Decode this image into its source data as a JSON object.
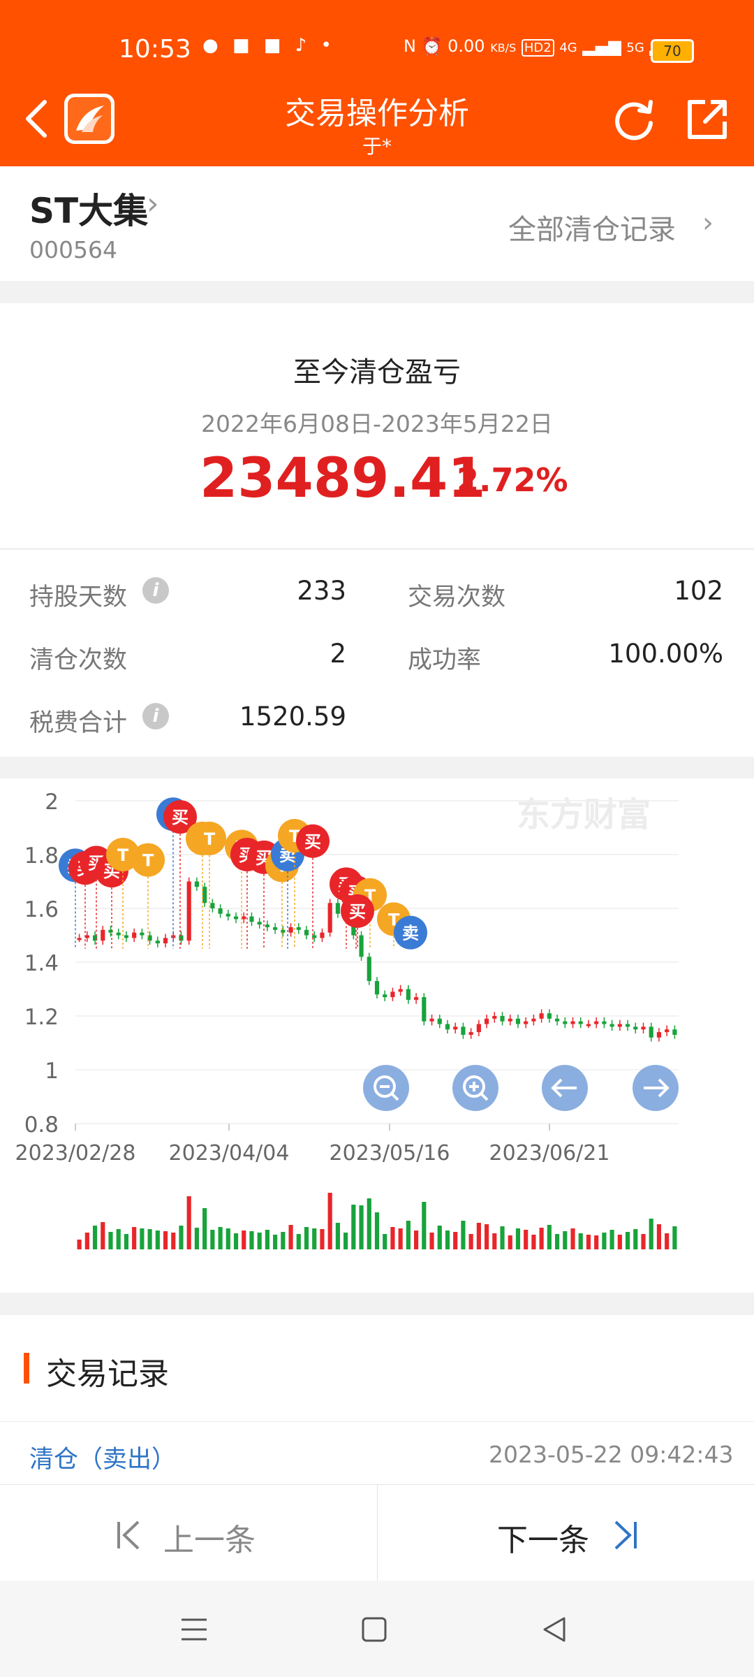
{
  "status_bar": {
    "time": "10:53",
    "net_speed": "0.00",
    "net_unit": "KB/S",
    "signal_4g": "4G",
    "signal_5g": "5G",
    "battery": "70",
    "hd": "HD2"
  },
  "header": {
    "title": "交易操作分析",
    "subtitle": "于*"
  },
  "stock": {
    "name": "ST大集",
    "code": "000564",
    "all_records_label": "全部清仓记录"
  },
  "pnl": {
    "title": "至今清仓盈亏",
    "date_range": "2022年6月08日-2023年5月22日",
    "amount": "23489.41",
    "percent": "2.72%"
  },
  "stats": {
    "holding_days_label": "持股天数",
    "holding_days": "233",
    "trade_count_label": "交易次数",
    "trade_count": "102",
    "clear_count_label": "清仓次数",
    "clear_count": "2",
    "success_rate_label": "成功率",
    "success_rate": "100.00%",
    "fees_label": "税费合计",
    "fees": "1520.59"
  },
  "chart_data": {
    "type": "candlestick",
    "watermark": "东方财富",
    "ylim": [
      0.8,
      2.0
    ],
    "yticks": [
      "2",
      "1.8",
      "1.6",
      "1.4",
      "1.2",
      "1",
      "0.8"
    ],
    "xticks": [
      "2023/02/28",
      "2023/04/04",
      "2023/05/16",
      "2023/06/21"
    ],
    "price_series": [
      1.49,
      1.5,
      1.48,
      1.52,
      1.51,
      1.5,
      1.49,
      1.51,
      1.5,
      1.48,
      1.47,
      1.49,
      1.5,
      1.48,
      1.7,
      1.68,
      1.62,
      1.6,
      1.58,
      1.57,
      1.56,
      1.57,
      1.55,
      1.54,
      1.53,
      1.52,
      1.51,
      1.53,
      1.52,
      1.5,
      1.49,
      1.51,
      1.62,
      1.58,
      1.57,
      1.5,
      1.42,
      1.33,
      1.28,
      1.27,
      1.29,
      1.3,
      1.26,
      1.27,
      1.18,
      1.19,
      1.17,
      1.15,
      1.16,
      1.13,
      1.14,
      1.17,
      1.19,
      1.2,
      1.18,
      1.19,
      1.17,
      1.18,
      1.19,
      1.21,
      1.19,
      1.18,
      1.17,
      1.18,
      1.17,
      1.17,
      1.18,
      1.17,
      1.16,
      1.17,
      1.16,
      1.15,
      1.16,
      1.12,
      1.14,
      1.15,
      1.13
    ],
    "markers": [
      {
        "label": "卖",
        "color": "#3a7bd5",
        "price": 1.76
      },
      {
        "label": "买",
        "color": "#e8262a",
        "price": 1.75
      },
      {
        "label": "买",
        "color": "#e8262a",
        "price": 1.77
      },
      {
        "label": "买",
        "color": "#e8262a",
        "price": 1.74
      },
      {
        "label": "T",
        "color": "#f5a623",
        "price": 1.8
      },
      {
        "label": "T",
        "color": "#f5a623",
        "price": 1.78
      },
      {
        "label": "卖",
        "color": "#3a7bd5",
        "price": 1.95
      },
      {
        "label": "买",
        "color": "#e8262a",
        "price": 1.94
      },
      {
        "label": "T",
        "color": "#f5a623",
        "price": 1.86
      },
      {
        "label": "T",
        "color": "#f5a623",
        "price": 1.86
      },
      {
        "label": "T",
        "color": "#f5a623",
        "price": 1.83
      },
      {
        "label": "买",
        "color": "#e8262a",
        "price": 1.8
      },
      {
        "label": "买",
        "color": "#e8262a",
        "price": 1.79
      },
      {
        "label": "T",
        "color": "#f5a623",
        "price": 1.76
      },
      {
        "label": "卖",
        "color": "#3a7bd5",
        "price": 1.8
      },
      {
        "label": "T",
        "color": "#f5a623",
        "price": 1.87
      },
      {
        "label": "买",
        "color": "#e8262a",
        "price": 1.85
      },
      {
        "label": "买",
        "color": "#e8262a",
        "price": 1.69
      },
      {
        "label": "买",
        "color": "#e8262a",
        "price": 1.66
      },
      {
        "label": "T",
        "color": "#f5a623",
        "price": 1.65
      },
      {
        "label": "买",
        "color": "#e8262a",
        "price": 1.59
      },
      {
        "label": "T",
        "color": "#f5a623",
        "price": 1.56
      },
      {
        "label": "卖",
        "color": "#3a7bd5",
        "price": 1.51
      }
    ]
  },
  "trade_records": {
    "title": "交易记录",
    "first_type": "清仓（卖出）",
    "first_time": "2023-05-22 09:42:43"
  },
  "nav": {
    "prev": "上一条",
    "next": "下一条"
  }
}
